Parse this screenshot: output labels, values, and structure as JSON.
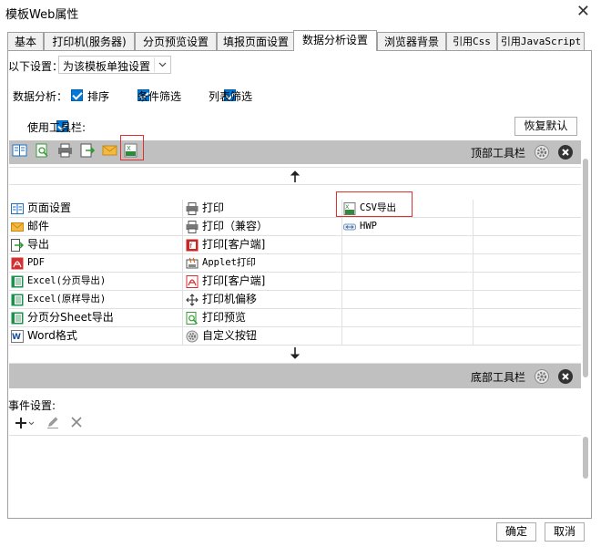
{
  "window": {
    "title": "模板Web属性"
  },
  "tabs": [
    {
      "label": "基本"
    },
    {
      "label": "打印机(服务器)"
    },
    {
      "label": "分页预览设置"
    },
    {
      "label": "填报页面设置"
    },
    {
      "label": "数据分析设置",
      "active": true
    },
    {
      "label": "浏览器背景"
    },
    {
      "label": "引用Css"
    },
    {
      "label": "引用JavaScript"
    }
  ],
  "settings": {
    "label": "以下设置：",
    "value": "为该模板单独设置"
  },
  "analysis": {
    "label": "数据分析：",
    "options": [
      {
        "label": "排序",
        "checked": true
      },
      {
        "label": "条件筛选",
        "checked": true
      },
      {
        "label": "列表筛选",
        "checked": true
      }
    ]
  },
  "toolbar": {
    "use_label": "使用工具栏:",
    "use_checked": true,
    "restore_label": "恢复默认"
  },
  "top_toolbar": {
    "label": "顶部工具栏",
    "icons": [
      "page-setup-icon",
      "print-preview-icon",
      "print-icon",
      "export-icon",
      "email-icon",
      "excel-icon"
    ]
  },
  "bottom_toolbar": {
    "label": "底部工具栏"
  },
  "items": {
    "col1": [
      {
        "label": "页面设置",
        "icon": "page-setup-icon"
      },
      {
        "label": "邮件",
        "icon": "email-icon"
      },
      {
        "label": "导出",
        "icon": "export-icon"
      },
      {
        "label": "PDF",
        "icon": "pdf-icon"
      },
      {
        "label": "Excel(分页导出)",
        "icon": "excel-icon"
      },
      {
        "label": "Excel(原样导出)",
        "icon": "excel-icon"
      },
      {
        "label": "分页分Sheet导出",
        "icon": "excel-icon"
      },
      {
        "label": "Word格式",
        "icon": "word-icon"
      }
    ],
    "col2": [
      {
        "label": "打印",
        "icon": "print-icon"
      },
      {
        "label": "打印（兼容）",
        "icon": "print-icon"
      },
      {
        "label": "打印[客户端]",
        "icon": "flash-print-icon"
      },
      {
        "label": "Applet打印",
        "icon": "applet-print-icon"
      },
      {
        "label": "打印[客户端]",
        "icon": "pdf-print-icon"
      },
      {
        "label": "打印机偏移",
        "icon": "move-icon"
      },
      {
        "label": "打印预览",
        "icon": "print-preview-icon"
      },
      {
        "label": "自定义按钮",
        "icon": "gear-icon"
      }
    ],
    "col3": [
      {
        "label": "CSV导出",
        "icon": "csv-icon"
      },
      {
        "label": "HWP",
        "icon": "hwp-icon"
      }
    ]
  },
  "events": {
    "label": "事件设置:"
  },
  "footer": {
    "ok": "确定",
    "cancel": "取消"
  },
  "colors": {
    "accent": "#0078d7",
    "highlight": "#e03030",
    "bar": "#c0c0c0"
  }
}
